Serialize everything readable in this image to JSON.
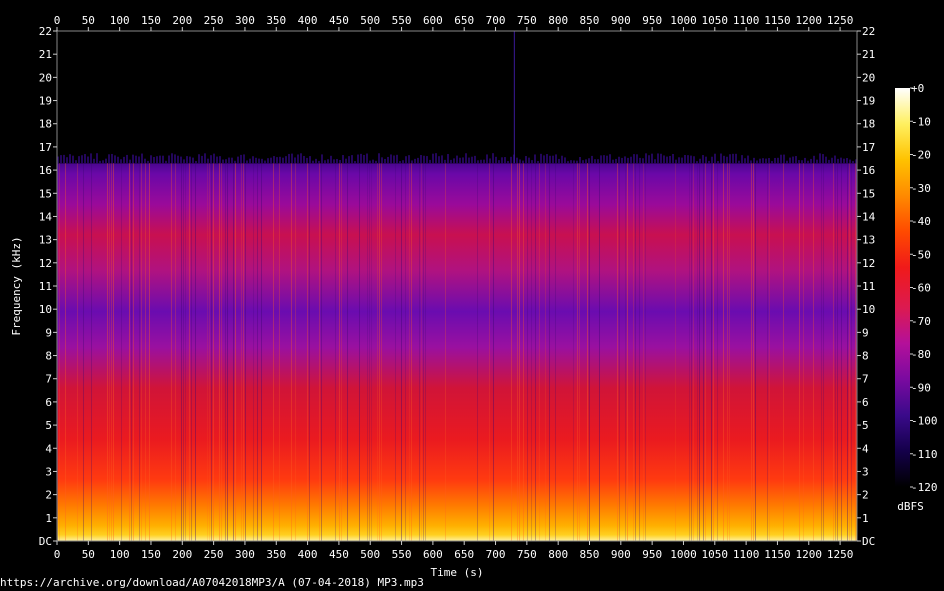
{
  "chart_data": {
    "type": "heatmap",
    "title": "",
    "xlabel": "Time (s)",
    "ylabel": "Frequency (kHz)",
    "xlim": [
      0,
      1277
    ],
    "ylim": [
      0,
      22
    ],
    "x_ticks": [
      0,
      50,
      100,
      150,
      200,
      250,
      300,
      350,
      400,
      450,
      500,
      550,
      600,
      650,
      700,
      750,
      800,
      850,
      900,
      950,
      1000,
      1050,
      1100,
      1150,
      1200,
      1250
    ],
    "y_ticks": [
      {
        "value": 0,
        "label": "DC"
      },
      {
        "value": 1,
        "label": "1"
      },
      {
        "value": 2,
        "label": "2"
      },
      {
        "value": 3,
        "label": "3"
      },
      {
        "value": 4,
        "label": "4"
      },
      {
        "value": 5,
        "label": "5"
      },
      {
        "value": 6,
        "label": "6"
      },
      {
        "value": 7,
        "label": "7"
      },
      {
        "value": 8,
        "label": "8"
      },
      {
        "value": 9,
        "label": "9"
      },
      {
        "value": 10,
        "label": "10"
      },
      {
        "value": 11,
        "label": "11"
      },
      {
        "value": 12,
        "label": "12"
      },
      {
        "value": 13,
        "label": "13"
      },
      {
        "value": 14,
        "label": "14"
      },
      {
        "value": 15,
        "label": "15"
      },
      {
        "value": 16,
        "label": "16"
      },
      {
        "value": 17,
        "label": "17"
      },
      {
        "value": 18,
        "label": "18"
      },
      {
        "value": 19,
        "label": "19"
      },
      {
        "value": 20,
        "label": "20"
      },
      {
        "value": 21,
        "label": "21"
      },
      {
        "value": 22,
        "label": "22"
      }
    ],
    "frequency_cutoff_khz": 16.3,
    "colorbar": {
      "label": "dBFS",
      "range": [
        -120,
        0
      ],
      "ticks": [
        {
          "value": 0,
          "label": "+0"
        },
        {
          "value": -10,
          "label": "-10"
        },
        {
          "value": -20,
          "label": "-20"
        },
        {
          "value": -30,
          "label": "-30"
        },
        {
          "value": -40,
          "label": "-40"
        },
        {
          "value": -50,
          "label": "-50"
        },
        {
          "value": -60,
          "label": "-60"
        },
        {
          "value": -70,
          "label": "-70"
        },
        {
          "value": -80,
          "label": "-80"
        },
        {
          "value": -90,
          "label": "-90"
        },
        {
          "value": -100,
          "label": "-100"
        },
        {
          "value": -110,
          "label": "-110"
        },
        {
          "value": -120,
          "label": "-120"
        }
      ],
      "colors": [
        "#000000",
        "#14004a",
        "#3a0a8a",
        "#7a0aa0",
        "#b4109a",
        "#dc1a50",
        "#f01a1a",
        "#ff4a00",
        "#ff8a00",
        "#ffc200",
        "#fff060",
        "#ffffff"
      ]
    },
    "grid": false
  },
  "footer": {
    "source": "https://archive.org/download/A07042018MP3/A (07-04-2018) MP3.mp3"
  }
}
